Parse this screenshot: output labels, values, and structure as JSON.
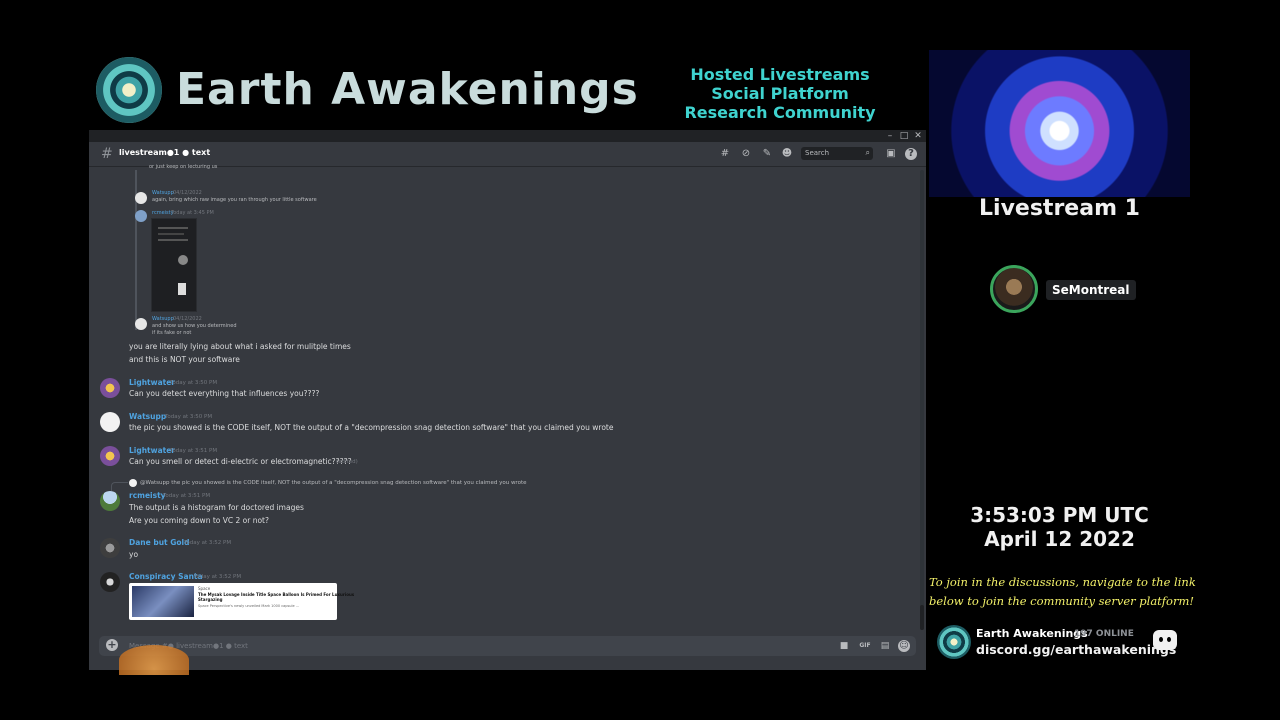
{
  "header": {
    "brand": "Earth Awakenings",
    "tagline_1": "Hosted Livestreams",
    "tagline_2": "Social Platform",
    "tagline_3": "Research Community"
  },
  "discord": {
    "channel_name": "livestream●1 ● text",
    "search_placeholder": "Search",
    "header_icons": [
      "threads-icon",
      "mute-icon",
      "pin-icon",
      "members-icon",
      "inbox-icon",
      "help-icon"
    ],
    "input_placeholder": "Message #● livestream●1 ● text",
    "input_icons": [
      "gift-icon",
      "gif-icon",
      "sticker-icon",
      "emoji-icon"
    ],
    "quoted": {
      "top_fragment": "or just keep on lecturing us",
      "q1_name": "Watsupp",
      "q1_time": "04/12/2022",
      "q1_text": "again, bring which raw image you ran through your little software",
      "q2_name": "rcmeisty",
      "q2_time": "Today at 3:45 PM",
      "q3_name": "Watsupp",
      "q3_time": "04/12/2022",
      "q3_text_1": "and show us how you determined",
      "q3_text_2": "if its fake or not"
    },
    "messages": [
      {
        "name": "",
        "time": "",
        "lines": [
          "you are literally lying about what i asked for mulitple times",
          "and this is NOT your software"
        ]
      },
      {
        "name": "Lightwater",
        "time": "Today at 3:50 PM",
        "lines": [
          "Can you detect everything that influences you????"
        ],
        "color": "#4fa3e0"
      },
      {
        "name": "Watsupp",
        "time": "Today at 3:50 PM",
        "lines": [
          "the pic you showed is the CODE itself, NOT the output of a \"decompression snag detection software\" that you claimed you wrote"
        ],
        "color": "#4fa3e0"
      },
      {
        "name": "Lightwater",
        "time": "Today at 3:51 PM",
        "lines": [
          "Can you smell or detect di-electric or electromagnetic?????"
        ],
        "edited": "(edited)",
        "color": "#4fa3e0"
      },
      {
        "name": "rcmeisty",
        "time": "Today at 3:51 PM",
        "reply": "@Watsupp the pic you showed is the CODE itself, NOT the output of a \"decompression snag detection software\" that you claimed you wrote",
        "lines": [
          "The output is a histogram for doctored images",
          "Are you coming down to VC 2 or not?"
        ],
        "color": "#4fa3e0"
      },
      {
        "name": "Dane but Gold",
        "time": "Today at 3:52 PM",
        "lines": [
          "yo"
        ],
        "color": "#4fa3e0"
      },
      {
        "name": "Conspiracy Santa",
        "time": "Today at 3:52 PM",
        "lines": [],
        "color": "#4fa3e0"
      }
    ],
    "embed": {
      "site": "Space",
      "title_1": "The Mysak Lovage Inside Title Space Balloon Is Primed For Luxurious",
      "title_2": "Stargazing",
      "desc": "Space Perspective's newly unveiled Mark 1000 capsule ..."
    }
  },
  "right": {
    "stream_title": "Livestream 1",
    "user": "SeMontreal",
    "time": "3:53:03 PM UTC",
    "date": "April 12 2022",
    "join_1": "To join in the discussions, navigate to the link",
    "join_2": "below to join the community server platform!",
    "footer_name": "Earth Awakenings",
    "footer_online": "197 ONLINE",
    "footer_link": "discord.gg/earthawakenings"
  },
  "colors": {
    "brand_text": "#c9dcdc",
    "tagline": "#3fd3cf",
    "join_text": "#f4f26a",
    "discord_bg": "#36393f",
    "username_blue": "#4fa3e0"
  }
}
